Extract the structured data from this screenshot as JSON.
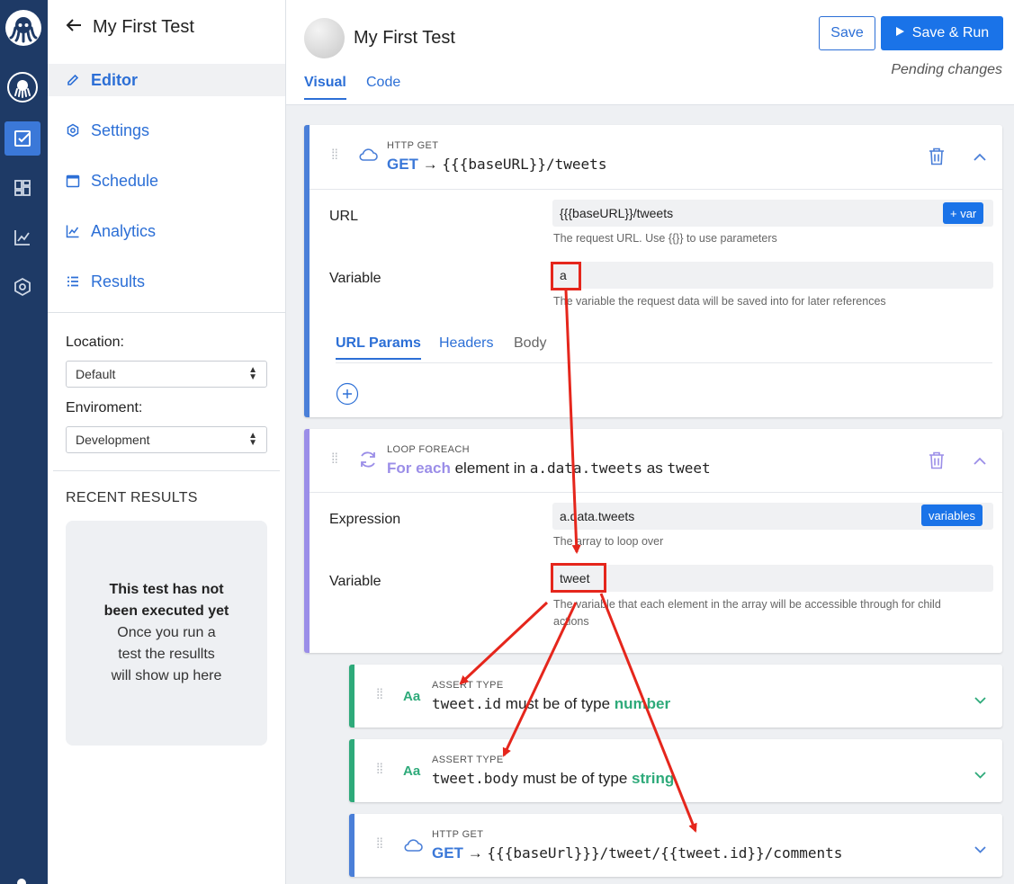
{
  "rail": {
    "icons": [
      "octopus-logo-icon",
      "octopus-avatar-icon",
      "check-square-icon",
      "dashboard-icon",
      "chart-line-icon",
      "settings-hex-icon"
    ]
  },
  "sidebar": {
    "title": "My First Test",
    "nav": [
      {
        "label": "Editor",
        "icon": "pencil-icon",
        "active": true
      },
      {
        "label": "Settings",
        "icon": "gear-icon"
      },
      {
        "label": "Schedule",
        "icon": "calendar-icon"
      },
      {
        "label": "Analytics",
        "icon": "chart-icon"
      },
      {
        "label": "Results",
        "icon": "list-icon"
      }
    ],
    "location_label": "Location:",
    "location_value": "Default",
    "environment_label": "Enviroment:",
    "environment_value": "Development",
    "recent_title": "RECENT RESULTS",
    "recent_bold_1": "This test has not",
    "recent_bold_2": "been executed yet",
    "recent_line_1": "Once you run a",
    "recent_line_2": "test the resullts",
    "recent_line_3": "will show up here"
  },
  "header": {
    "title": "My First Test",
    "tabs": [
      "Visual",
      "Code"
    ],
    "save_label": "Save",
    "save_run_label": "Save & Run",
    "status": "Pending changes"
  },
  "cards": {
    "http1": {
      "type": "HTTP GET",
      "method": "GET",
      "arrow": "→",
      "url": "{{{baseURL}}/tweets",
      "url_label": "URL",
      "url_value": "{{{baseURL}}/tweets",
      "var_button": "+ var",
      "url_help": "The request URL. Use {{}} to use parameters",
      "variable_label": "Variable",
      "variable_value": "a",
      "variable_help": "The variable the request data will be saved into for later references",
      "subtabs": [
        "URL Params",
        "Headers",
        "Body"
      ]
    },
    "loop": {
      "type": "LOOP FOREACH",
      "for_each": "For each",
      "element_in": "element in",
      "expr": "a.data.tweets",
      "as": "as",
      "alias": "tweet",
      "expression_label": "Expression",
      "expression_value": "a.data.tweets",
      "variables_button": "variables",
      "expression_help": "The array to loop over",
      "variable_label": "Variable",
      "variable_value": "tweet",
      "variable_help_1": "The variable that each element in the array will be accessible through for child",
      "variable_help_2": "actions"
    },
    "assert1": {
      "type": "ASSERT TYPE",
      "icon_text": "Aa",
      "subject": "tweet.id",
      "middle": "must be of type",
      "kind": "number"
    },
    "assert2": {
      "type": "ASSERT TYPE",
      "icon_text": "Aa",
      "subject": "tweet.body",
      "middle": "must be of type",
      "kind": "string"
    },
    "http2": {
      "type": "HTTP GET",
      "method": "GET",
      "arrow": "→",
      "url": "{{{baseUrl}}}/tweet/{{tweet.id}}/comments"
    }
  },
  "colors": {
    "rail": "#1e3a66",
    "accent": "#1a73e8",
    "loop": "#9b8ee8",
    "assert": "#2eaa7a",
    "annotation": "#e5261c"
  }
}
